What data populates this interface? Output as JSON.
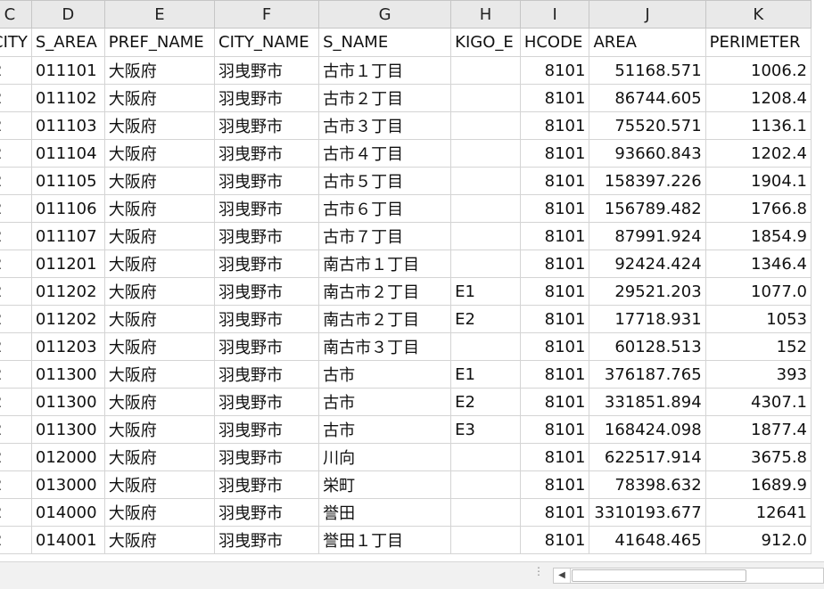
{
  "sheet": {
    "column_letters": [
      "C",
      "D",
      "E",
      "F",
      "G",
      "H",
      "I",
      "J",
      "K"
    ],
    "fields": [
      "CITY",
      "S_AREA",
      "PREF_NAME",
      "CITY_NAME",
      "S_NAME",
      "KIGO_E",
      "HCODE",
      "AREA",
      "PERIMETER"
    ],
    "rows": [
      [
        "2",
        "011101",
        "大阪府",
        "羽曳野市",
        "古市１丁目",
        "",
        "8101",
        "51168.571",
        "1006.2"
      ],
      [
        "2",
        "011102",
        "大阪府",
        "羽曳野市",
        "古市２丁目",
        "",
        "8101",
        "86744.605",
        "1208.4"
      ],
      [
        "2",
        "011103",
        "大阪府",
        "羽曳野市",
        "古市３丁目",
        "",
        "8101",
        "75520.571",
        "1136.1"
      ],
      [
        "2",
        "011104",
        "大阪府",
        "羽曳野市",
        "古市４丁目",
        "",
        "8101",
        "93660.843",
        "1202.4"
      ],
      [
        "2",
        "011105",
        "大阪府",
        "羽曳野市",
        "古市５丁目",
        "",
        "8101",
        "158397.226",
        "1904.1"
      ],
      [
        "2",
        "011106",
        "大阪府",
        "羽曳野市",
        "古市６丁目",
        "",
        "8101",
        "156789.482",
        "1766.8"
      ],
      [
        "2",
        "011107",
        "大阪府",
        "羽曳野市",
        "古市７丁目",
        "",
        "8101",
        "87991.924",
        "1854.9"
      ],
      [
        "2",
        "011201",
        "大阪府",
        "羽曳野市",
        "南古市１丁目",
        "",
        "8101",
        "92424.424",
        "1346.4"
      ],
      [
        "2",
        "011202",
        "大阪府",
        "羽曳野市",
        "南古市２丁目",
        "E1",
        "8101",
        "29521.203",
        "1077.0"
      ],
      [
        "2",
        "011202",
        "大阪府",
        "羽曳野市",
        "南古市２丁目",
        "E2",
        "8101",
        "17718.931",
        "1053"
      ],
      [
        "2",
        "011203",
        "大阪府",
        "羽曳野市",
        "南古市３丁目",
        "",
        "8101",
        "60128.513",
        "152"
      ],
      [
        "2",
        "011300",
        "大阪府",
        "羽曳野市",
        "古市",
        "E1",
        "8101",
        "376187.765",
        "393"
      ],
      [
        "2",
        "011300",
        "大阪府",
        "羽曳野市",
        "古市",
        "E2",
        "8101",
        "331851.894",
        "4307.1"
      ],
      [
        "2",
        "011300",
        "大阪府",
        "羽曳野市",
        "古市",
        "E3",
        "8101",
        "168424.098",
        "1877.4"
      ],
      [
        "2",
        "012000",
        "大阪府",
        "羽曳野市",
        "川向",
        "",
        "8101",
        "622517.914",
        "3675.8"
      ],
      [
        "2",
        "013000",
        "大阪府",
        "羽曳野市",
        "栄町",
        "",
        "8101",
        "78398.632",
        "1689.9"
      ],
      [
        "2",
        "014000",
        "大阪府",
        "羽曳野市",
        "誉田",
        "",
        "8101",
        "3310193.677",
        "12641"
      ],
      [
        "2",
        "014001",
        "大阪府",
        "羽曳野市",
        "誉田１丁目",
        "",
        "8101",
        "41648.465",
        "912.0"
      ]
    ],
    "numeric_columns": [
      0,
      6,
      7,
      8
    ]
  },
  "statusbar": {
    "grip_icon": "vertical-dots-icon",
    "scroll_left_icon": "arrow-left-icon"
  },
  "colors": {
    "header_bg": "#e9e9e9",
    "gridline": "#d4d4d4",
    "statusbar_bg": "#f1f1f1"
  }
}
